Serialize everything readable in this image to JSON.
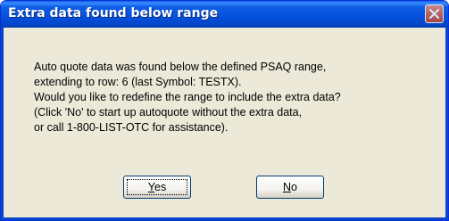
{
  "dialog": {
    "title": "Extra data found below range",
    "message": [
      "Auto quote data was found below the defined PSAQ range,",
      "extending to row: 6 (last Symbol: TESTX).",
      "Would you like to redefine the range to include the extra data?",
      "(Click 'No' to start up autoquote without the extra data,",
      "or call 1-800-LIST-OTC for assistance)."
    ],
    "buttons": {
      "yes": {
        "mnemonic": "Y",
        "rest": "es"
      },
      "no": {
        "mnemonic": "N",
        "rest": "o"
      }
    },
    "close_icon": "close-icon"
  },
  "colors": {
    "titlebar": "#0550DC",
    "dialog_bg": "#ECE9D8",
    "close_button": "#D9694E"
  }
}
